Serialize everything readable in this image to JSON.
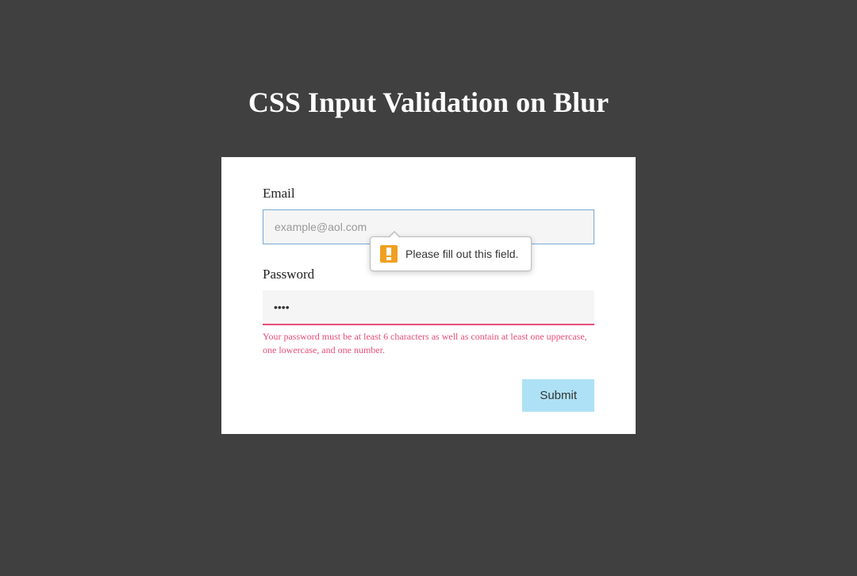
{
  "page": {
    "title": "CSS Input Validation on Blur"
  },
  "form": {
    "email": {
      "label": "Email",
      "placeholder": "example@aol.com",
      "value": ""
    },
    "password": {
      "label": "Password",
      "value": "••••",
      "error": "Your password must be at least 6 characters as well as contain at least one uppercase, one lowercase, and one number."
    },
    "submit": {
      "label": "Submit"
    }
  },
  "tooltip": {
    "message": "Please fill out this field."
  }
}
